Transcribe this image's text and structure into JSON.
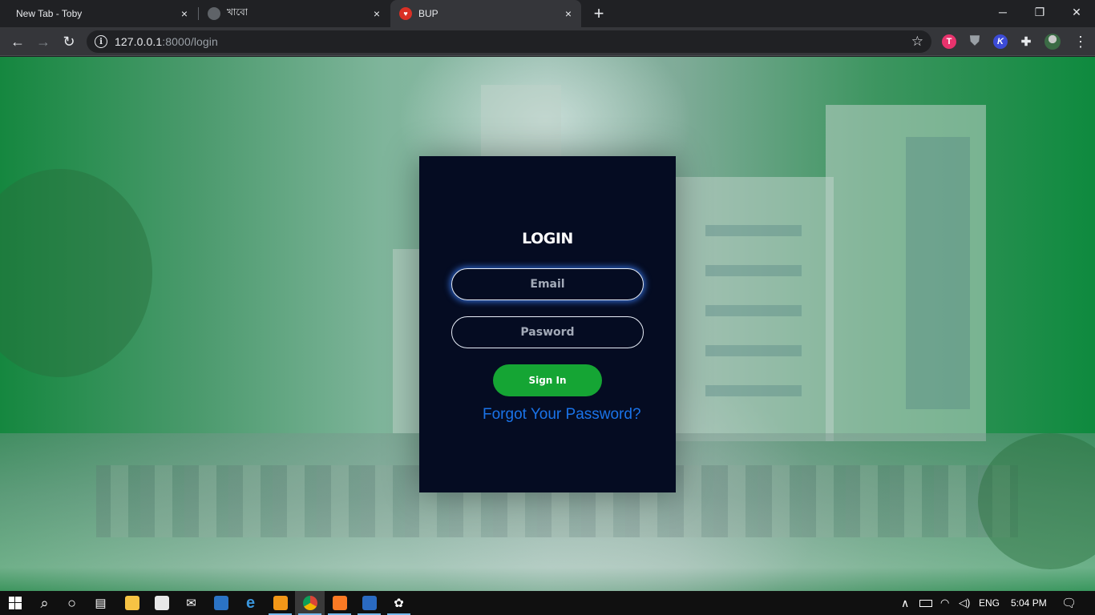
{
  "browser": {
    "tabs": [
      {
        "title": "New Tab - Toby",
        "close": "×"
      },
      {
        "title": "খাবো",
        "close": "×"
      },
      {
        "title": "BUP",
        "close": "×"
      }
    ],
    "new_tab": "+",
    "window_controls": {
      "minimize": "─",
      "restore": "❐",
      "close": "✕"
    },
    "nav": {
      "back": "←",
      "forward": "→",
      "reload": "↻"
    },
    "address": {
      "host": "127.0.0.1",
      "path": ":8000/login"
    },
    "bookmark_star": "☆",
    "extensions": [
      {
        "icon": "toby-extension-icon",
        "glyph": "T",
        "color": "#e8336d"
      },
      {
        "icon": "shield-extension-icon",
        "glyph": "⛊",
        "color": "#9aa0a6"
      },
      {
        "icon": "k-extension-icon",
        "glyph": "K",
        "color": "#3c4bd6"
      },
      {
        "icon": "puzzle-extensions-icon",
        "glyph": "✚",
        "color": "#e8eaed"
      }
    ],
    "menu": "⋮"
  },
  "login": {
    "title": "LOGIN",
    "email_placeholder": "Email",
    "password_placeholder": "Pasword",
    "sign_in": "Sign In",
    "forgot": "Forgot Your Password?"
  },
  "taskbar": {
    "apps": [
      {
        "icon": "search-icon",
        "glyph": "⌕"
      },
      {
        "icon": "cortana-icon",
        "glyph": "○"
      },
      {
        "icon": "task-view-icon",
        "glyph": "▤"
      },
      {
        "icon": "file-explorer-icon",
        "glyph": "📁"
      },
      {
        "icon": "store-icon",
        "glyph": "🛍"
      },
      {
        "icon": "mail-icon",
        "glyph": "✉"
      },
      {
        "icon": "app-icon",
        "glyph": "▣"
      },
      {
        "icon": "edge-icon",
        "glyph": "e"
      },
      {
        "icon": "sublime-icon",
        "glyph": "S"
      },
      {
        "icon": "chrome-icon",
        "glyph": "◉"
      },
      {
        "icon": "xampp-icon",
        "glyph": "✖"
      },
      {
        "icon": "powershell-icon",
        "glyph": "❯"
      },
      {
        "icon": "paint-icon",
        "glyph": "✿"
      }
    ],
    "tray": {
      "chevron": "∧",
      "language": "ENG",
      "time": "5:04 PM",
      "notification": "🗨"
    }
  }
}
